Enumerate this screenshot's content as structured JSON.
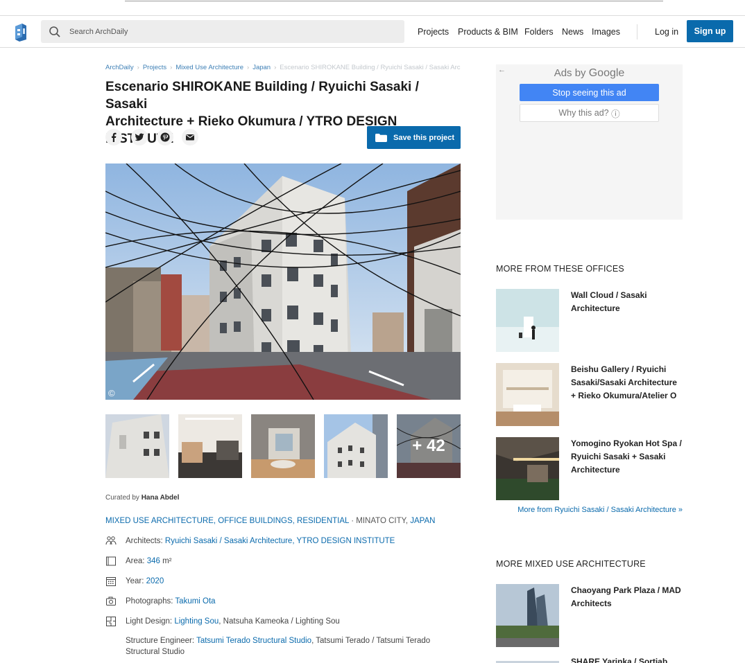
{
  "header": {
    "search_placeholder": "Search ArchDaily",
    "nav": [
      "Projects",
      "Products & BIM",
      "Folders",
      "News",
      "Images"
    ],
    "login": "Log in",
    "signup": "Sign up"
  },
  "breadcrumb": [
    "ArchDaily",
    "Projects",
    "Mixed Use Architecture",
    "Japan",
    "Escenario SHIROKANE Building / Ryuichi Sasaki / Sasaki Architecture + Rieko Okumura / YTRO DESIGN INSTITUTE"
  ],
  "title_line1": "Escenario SHIROKANE Building / Ryuichi Sasaki / Sasaki",
  "title_line2": "Architecture + Rieko Okumura / YTRO DESIGN INSTITUTE",
  "save_label": "Save this project",
  "more_photos": "+ 42",
  "copyright_symbol": "©",
  "curated": {
    "prefix": "Curated by",
    "name": "Hana Abdel"
  },
  "categories": {
    "links": "MIXED USE ARCHITECTURE, OFFICE BUILDINGS, RESIDENTIAL",
    "dot": " · ",
    "city": "MINATO CITY, ",
    "country": "JAPAN"
  },
  "specs": {
    "architects_label": "Architects:",
    "architects_value": "Ryuichi Sasaki / Sasaki Architecture, YTRO DESIGN INSTITUTE",
    "area_label": "Area:",
    "area_value": "346",
    "area_unit": " m²",
    "year_label": "Year:",
    "year_value": "2020",
    "photographs_label": "Photographs:",
    "photographs_value": "Takumi Ota",
    "light_label": "Light Design:",
    "light_link": "Lighting Sou",
    "light_rest": ", Natsuha Kameoka / Lighting Sou",
    "structure_label": "Structure Engineer:",
    "structure_link": "Tatsumi Terado Structural Studio",
    "structure_rest": ", Tatsumi Terado / Tatsumi Terado Structural Studio"
  },
  "ad": {
    "back": "←",
    "ads_by": "Ads by",
    "google": "Google",
    "stop": "Stop seeing this ad",
    "why": "Why this ad?",
    "info": "ⓘ"
  },
  "sidebar": {
    "offices_heading": "MORE FROM THESE OFFICES",
    "offices": [
      {
        "title": "Wall Cloud / Sasaki Architecture"
      },
      {
        "title": "Beishu Gallery / Ryuichi Sasaki/Sasaki Architecture + Rieko Okumura/Atelier O"
      },
      {
        "title": "Yomogino Ryokan Hot Spa / Ryuichi Sasaki + Sasaki Architecture"
      }
    ],
    "more_link": "More from Ryuichi Sasaki / Sasaki Architecture »",
    "mixed_heading": "MORE MIXED USE ARCHITECTURE",
    "mixed": [
      {
        "title": "Chaoyang Park Plaza / MAD Architects"
      },
      {
        "title": "SHARE Yarinka / Sortiab"
      }
    ]
  },
  "colors": {
    "brand": "#0a6aac",
    "google_blue": "#4285f4"
  }
}
